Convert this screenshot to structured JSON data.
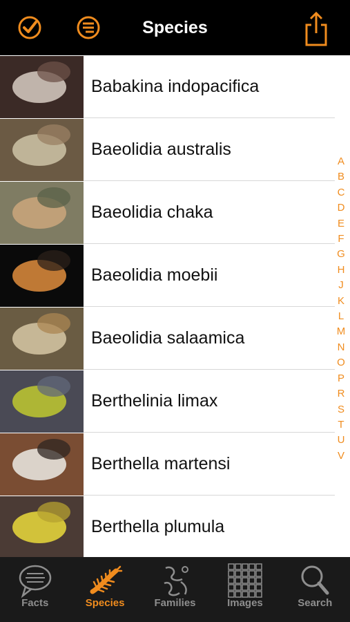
{
  "header": {
    "title": "Species",
    "accent_color": "#f08c1e",
    "left_icons": [
      "checkmark-circle-icon",
      "filter-list-icon"
    ],
    "right_icon": "share-icon"
  },
  "species": [
    {
      "name": "Babakina indopacifica",
      "colors": [
        "#3b2a26",
        "#cfc3ba",
        "#6d5248"
      ]
    },
    {
      "name": "Baeolidia australis",
      "colors": [
        "#6b5a44",
        "#c9bea2",
        "#998063"
      ]
    },
    {
      "name": "Baeolidia chaka",
      "colors": [
        "#7f7c63",
        "#c8a47a",
        "#5a6248"
      ]
    },
    {
      "name": "Baeolidia moebii",
      "colors": [
        "#0a0a0a",
        "#d3853a",
        "#2b2019"
      ]
    },
    {
      "name": "Baeolidia salaamica",
      "colors": [
        "#6a5c43",
        "#d0c1a0",
        "#ab8651"
      ]
    },
    {
      "name": "Berthelinia limax",
      "colors": [
        "#4a4a55",
        "#b9c232",
        "#62687a"
      ]
    },
    {
      "name": "Berthella martensi",
      "colors": [
        "#7a4d33",
        "#e6e2da",
        "#2f2622"
      ]
    },
    {
      "name": "Berthella plumula",
      "colors": [
        "#4b3b35",
        "#e1d23b",
        "#b6a230"
      ]
    }
  ],
  "alphabet_index": [
    "A",
    "B",
    "C",
    "D",
    "E",
    "F",
    "G",
    "H",
    "J",
    "K",
    "L",
    "M",
    "N",
    "O",
    "P",
    "R",
    "S",
    "T",
    "U",
    "V"
  ],
  "tabs": [
    {
      "label": "Facts",
      "icon": "speech-bubble-icon",
      "active": false
    },
    {
      "label": "Species",
      "icon": "nudibranch-icon",
      "active": true
    },
    {
      "label": "Families",
      "icon": "family-tree-icon",
      "active": false
    },
    {
      "label": "Images",
      "icon": "image-grid-icon",
      "active": false
    },
    {
      "label": "Search",
      "icon": "search-icon",
      "active": false
    }
  ]
}
